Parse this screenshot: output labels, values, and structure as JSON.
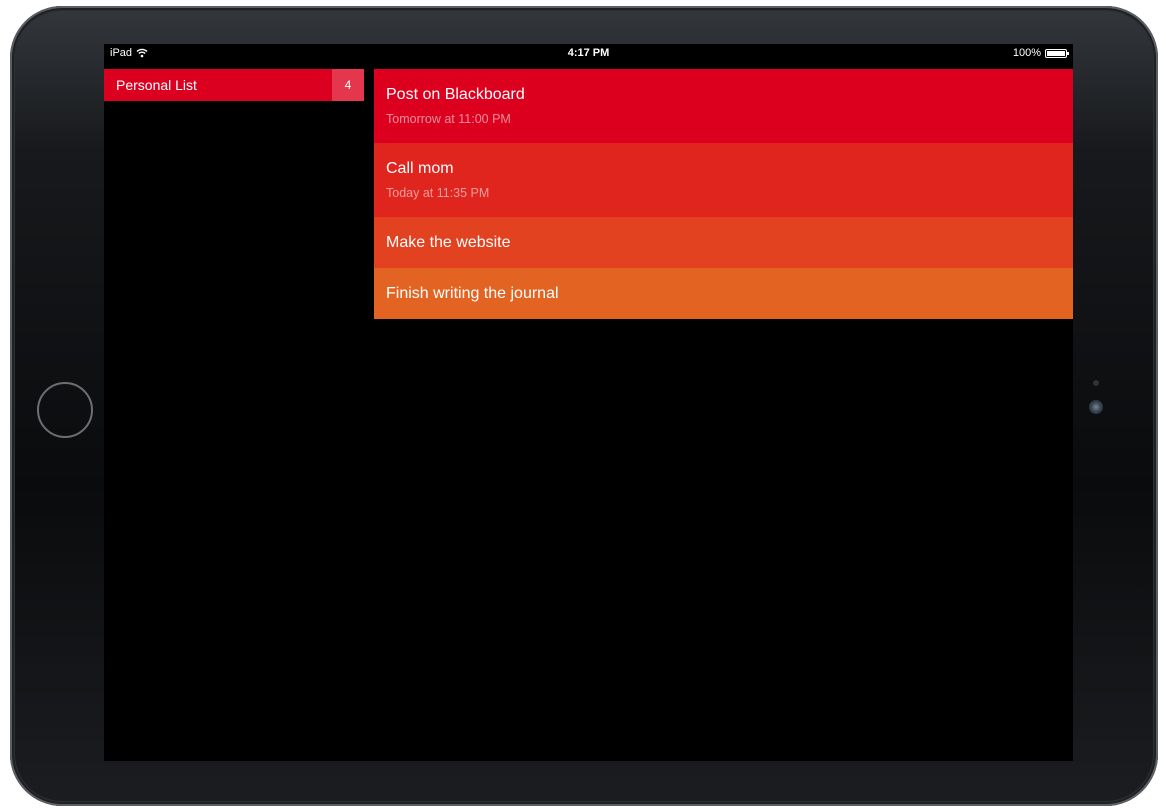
{
  "status_bar": {
    "device": "iPad",
    "time": "4:17 PM",
    "battery": "100%",
    "battery_level": 1.0
  },
  "sidebar": {
    "lists": [
      {
        "name": "Personal List",
        "count": "4",
        "color": "#dc0020",
        "count_bg": "#e4364c"
      }
    ]
  },
  "tasks": [
    {
      "title": "Post on Blackboard",
      "due": "Tomorrow at 11:00 PM",
      "color": "#dc001e"
    },
    {
      "title": "Call mom",
      "due": "Today at 11:35 PM",
      "color": "#e0241e"
    },
    {
      "title": "Make the website",
      "due": "",
      "color": "#e24220"
    },
    {
      "title": "Finish writing the journal",
      "due": "",
      "color": "#e36322"
    }
  ],
  "icons": [
    "wifi-icon",
    "battery-icon",
    "home-button",
    "camera-icon"
  ]
}
